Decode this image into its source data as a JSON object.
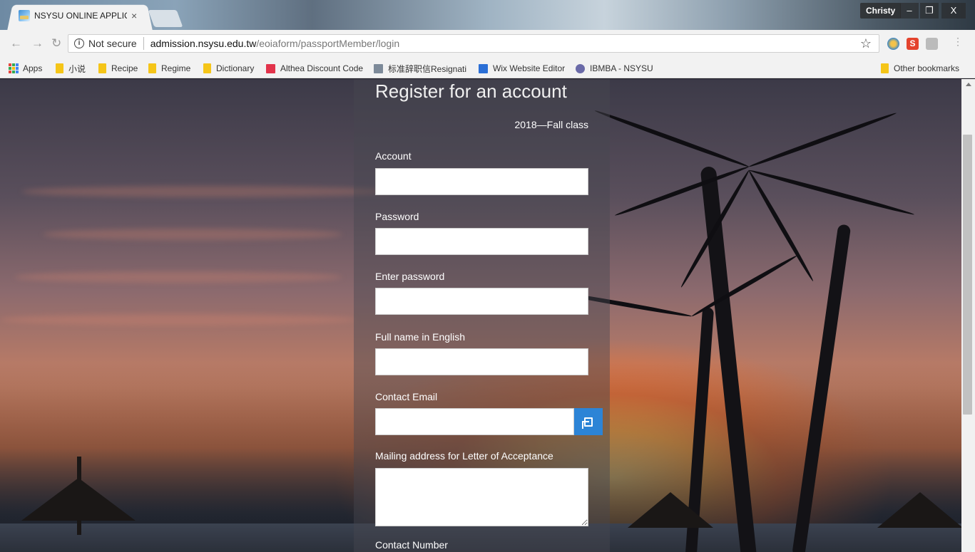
{
  "browser": {
    "tab_title": "NSYSU ONLINE APPLICA",
    "tab_close": "×",
    "profile_name": "Christy",
    "window_controls": [
      "–",
      "❐",
      "X"
    ],
    "address": {
      "security_label": "Not secure",
      "url_host": "admission.nsysu.edu.tw",
      "url_path": "/eoiaform/passportMember/login"
    },
    "bookmarks": [
      {
        "label": "Apps",
        "icon": "apps-grid-icon"
      },
      {
        "label": "小说",
        "icon": "folder-icon"
      },
      {
        "label": "Recipe",
        "icon": "folder-icon"
      },
      {
        "label": "Regime",
        "icon": "folder-icon"
      },
      {
        "label": "Dictionary",
        "icon": "folder-icon"
      },
      {
        "label": "Althea Discount Code",
        "icon": "site-favicon"
      },
      {
        "label": "标准辞职信Resignati",
        "icon": "site-favicon"
      },
      {
        "label": "Wix Website Editor",
        "icon": "wix-favicon"
      },
      {
        "label": "IBMBA - NSYSU",
        "icon": "globe-icon"
      }
    ],
    "other_bookmarks": "Other bookmarks"
  },
  "form": {
    "title": "Register for an account",
    "class_label": "2018—Fall class",
    "fields": {
      "account": {
        "label": "Account",
        "value": ""
      },
      "password": {
        "label": "Password",
        "value": ""
      },
      "enter_password": {
        "label": "Enter password",
        "value": ""
      },
      "full_name": {
        "label": "Full name in English",
        "value": ""
      },
      "email": {
        "label": "Contact Email",
        "value": ""
      },
      "address": {
        "label": "Mailing address for Letter of Acceptance",
        "value": ""
      },
      "contact_number": {
        "label": "Contact Number"
      }
    }
  },
  "colors": {
    "email_addon": "#2c84d6",
    "bookmark_folder": "#f5c518"
  }
}
